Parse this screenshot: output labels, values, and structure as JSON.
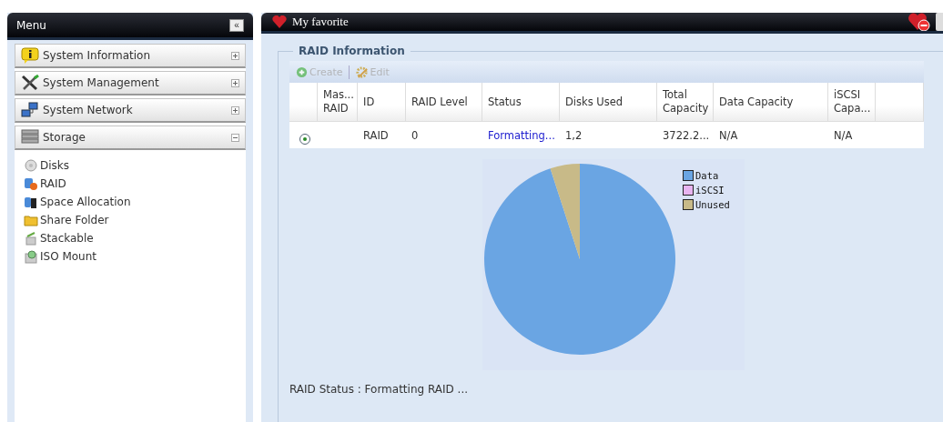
{
  "sidebar": {
    "title": "Menu",
    "collapse_glyph": "«",
    "sections": [
      {
        "label": "System Information",
        "expanded": false
      },
      {
        "label": "System Management",
        "expanded": false
      },
      {
        "label": "System Network",
        "expanded": false
      },
      {
        "label": "Storage",
        "expanded": true,
        "children": [
          {
            "label": "Disks"
          },
          {
            "label": "RAID"
          },
          {
            "label": "Space Allocation"
          },
          {
            "label": "Share Folder"
          },
          {
            "label": "Stackable"
          },
          {
            "label": "ISO Mount"
          }
        ]
      }
    ]
  },
  "main": {
    "title": "My favorite",
    "panel_title": "RAID Information",
    "toolbar": [
      {
        "label": "Create",
        "disabled": true
      },
      {
        "label": "Edit",
        "disabled": true
      }
    ],
    "table": {
      "columns": [
        "",
        "Mas... RAID",
        "ID",
        "RAID Level",
        "Status",
        "Disks Used",
        "Total Capacity",
        "Data Capacity",
        "iSCSI Capa...",
        ""
      ],
      "rows": [
        {
          "selected": true,
          "cells": [
            "",
            "",
            "RAID",
            "0",
            "Formatting...",
            "1,2",
            "3722.2...",
            "N/A",
            "N/A",
            ""
          ]
        }
      ]
    },
    "chart_legend": [
      {
        "label": "Data",
        "color": "#6aa5e3"
      },
      {
        "label": "iSCSI",
        "color": "#e8b4f0"
      },
      {
        "label": "Unused",
        "color": "#c8ba88"
      }
    ],
    "status_text": "RAID Status : Formatting RAID ..."
  }
}
